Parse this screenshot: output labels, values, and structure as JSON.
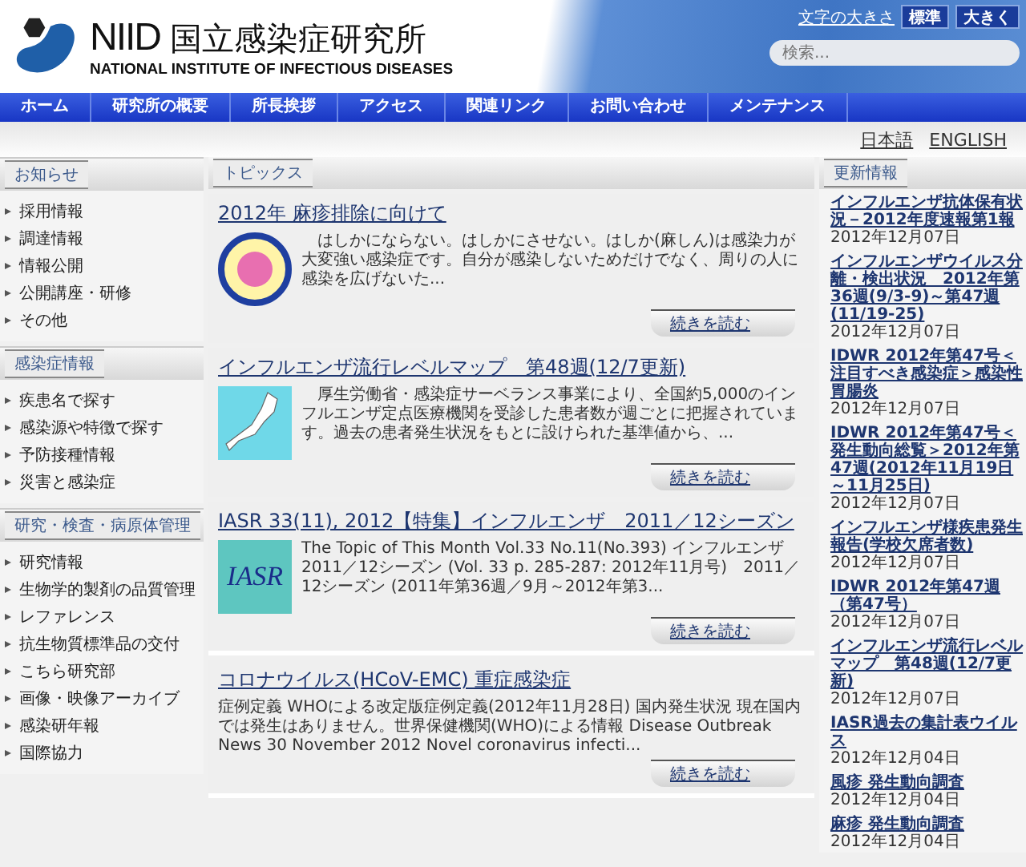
{
  "header": {
    "logo_mark": "NIID",
    "title": "国立感染症研究所",
    "subtitle": "NATIONAL INSTITUTE OF INFECTIOUS DISEASES",
    "font_size_label": "文字の大きさ",
    "font_size_buttons": [
      {
        "label": "標準",
        "selected": false
      },
      {
        "label": "大きく",
        "selected": false
      }
    ],
    "search": {
      "placeholder": "検索..."
    }
  },
  "nav": [
    "ホーム",
    "研究所の概要",
    "所長挨拶",
    "アクセス",
    "関連リンク",
    "お問い合わせ",
    "メンテナンス"
  ],
  "languages": [
    "日本語",
    "ENGLISH"
  ],
  "sidebar": [
    {
      "title": "お知らせ",
      "items": [
        "採用情報",
        "調達情報",
        "情報公開",
        "公開講座・研修",
        "その他"
      ]
    },
    {
      "title": "感染症情報",
      "items": [
        "疾患名で探す",
        "感染源や特徴で探す",
        "予防接種情報",
        "災害と感染症"
      ]
    },
    {
      "title": "研究・検査・病原体管理",
      "items": [
        "研究情報",
        "生物学的製剤の品質管理",
        "レファレンス",
        "抗生物質標準品の交付",
        "こちら研究部",
        "画像・映像アーカイブ",
        "感染研年報",
        "国際協力"
      ]
    }
  ],
  "topics": {
    "title": "トピックス",
    "articles": [
      {
        "title": "2012年 麻疹排除に向けて",
        "kind": "heart",
        "body": "　はしかにならない。はしかにさせない。はしか(麻しん)は感染力が大変強い感染症です。自分が感染しないためだけでなく、周りの人に感染を広げないた...",
        "more": "続きを読む"
      },
      {
        "title": "インフルエンザ流行レベルマップ　第48週(12/7更新)",
        "kind": "map",
        "body": "　厚生労働省・感染症サーベランス事業により、全国約5,000のインフルエンザ定点医療機関を受診した患者数が週ごとに把握されています。過去の患者発生状況をもとに設けられた基準値から、...",
        "more": "続きを読む"
      },
      {
        "title": "IASR 33(11), 2012【特集】インフルエンザ　2011／12シーズン",
        "kind": "iasr",
        "thumb_text": "IASR",
        "body": "The Topic of This Month Vol.33 No.11(No.393) インフルエンザ　2011／12シーズン (Vol. 33 p. 285-287: 2012年11月号)　2011／12シーズン (2011年第36週／9月～2012年第3...",
        "more": "続きを読む"
      },
      {
        "title": "コロナウイルス(HCoV-EMC) 重症感染症",
        "kind": "text",
        "body": "症例定義 WHOによる改定版症例定義(2012年11月28日) 国内発生状況 現在国内では発生はありません。世界保健機関(WHO)による情報 Disease Outbreak News 30 November 2012 Novel coronavirus infecti...",
        "more": "続きを読む"
      }
    ]
  },
  "updates": {
    "title": "更新情報",
    "items": [
      {
        "title": "インフルエンザ抗体保有状況－2012年度速報第1報",
        "date": "2012年12月07日"
      },
      {
        "title": "インフルエンザウイルス分離・検出状況　2012年第36週(9/3-9)～第47週(11/19-25)",
        "date": "2012年12月07日"
      },
      {
        "title": "IDWR 2012年第47号＜注目すべき感染症＞感染性胃腸炎",
        "date": "2012年12月07日"
      },
      {
        "title": "IDWR 2012年第47号＜発生動向総覧＞2012年第47週(2012年11月19日～11月25日)",
        "date": "2012年12月07日"
      },
      {
        "title": "インフルエンザ様疾患発生報告(学校欠席者数)",
        "date": "2012年12月07日"
      },
      {
        "title": "IDWR 2012年第47週（第47号）",
        "date": "2012年12月07日"
      },
      {
        "title": "インフルエンザ流行レベルマップ　第48週(12/7更新)",
        "date": "2012年12月07日"
      },
      {
        "title": "IASR過去の集計表ウイルス",
        "date": "2012年12月04日"
      },
      {
        "title": "風疹 発生動向調査",
        "date": "2012年12月04日"
      },
      {
        "title": "麻疹 発生動向調査",
        "date": "2012年12月04日"
      }
    ]
  }
}
